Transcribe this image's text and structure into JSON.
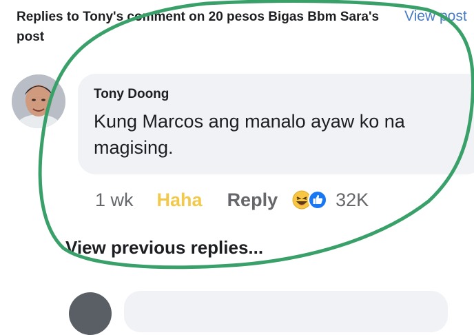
{
  "header": {
    "title": "Replies to Tony's comment on 20 pesos Bigas Bbm Sara's post",
    "view_post": "View post"
  },
  "comment": {
    "author": "Tony Doong",
    "text": "Kung Marcos ang manalo ayaw ko na magising.",
    "time": "1 wk",
    "reaction_label": "Haha",
    "reply_label": "Reply",
    "reaction_count": "32K",
    "reaction_icons": [
      "haha-emoji-icon",
      "like-icon"
    ]
  },
  "view_previous": "View previous replies...",
  "colors": {
    "background": "#ffffff",
    "bubble": "#f0f2f5",
    "link": "#4a7cc4",
    "haha": "#f2c94c",
    "secondary_text": "#65676b",
    "like": "#1877f2",
    "annotation": "#3aa06a"
  }
}
